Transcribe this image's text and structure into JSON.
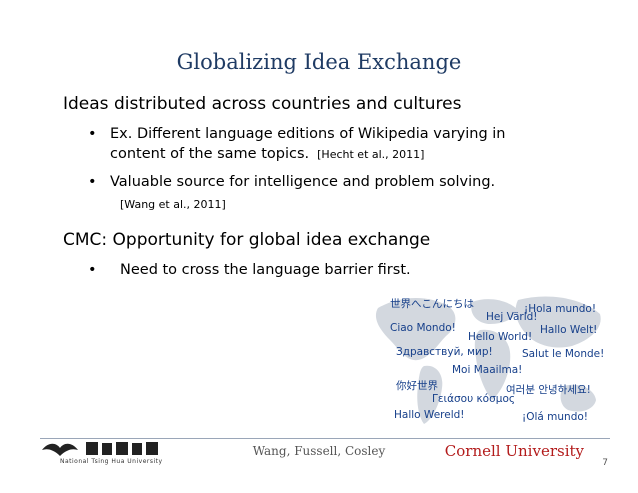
{
  "slide": {
    "title": "Globalizing Idea Exchange",
    "heading1": "Ideas distributed across countries and cultures",
    "bullet1_line1": "Ex. Different language editions of Wikipedia varying in",
    "bullet1_line2": "content of the same topics.",
    "bullet1_cite": "[Hecht et al., 2011]",
    "bullet2": "Valuable source for intelligence and problem solving.",
    "bullet2_cite": "[Wang et al., 2011]",
    "heading2": "CMC: Opportunity for global idea exchange",
    "bullet3": "Need to cross the language barrier first.",
    "bullet_mark": "•"
  },
  "greetings": [
    "世界へこんにちは",
    "Hej Värld!",
    "¡Hola mundo!",
    "Ciao Mondo!",
    "Hello World!",
    "Hallo Welt!",
    "Здравствуй, мир!",
    "Salut le Monde!",
    "Moi Maailma!",
    "你好世界",
    "여러분 안녕하세요!",
    "Γειάσου κόσμος",
    "Hallo Wereld!",
    "¡Olá mundo!"
  ],
  "footer": {
    "authors": "Wang, Fussell, Cosley",
    "university_right": "Cornell University",
    "page_number": "7",
    "left_logo_subtext": "National Tsing Hua University"
  },
  "colors": {
    "title": "#1f3b64",
    "greeting_text": "#163f8a",
    "cornell_red": "#b31b1b",
    "map_land": "#d3d8df"
  }
}
